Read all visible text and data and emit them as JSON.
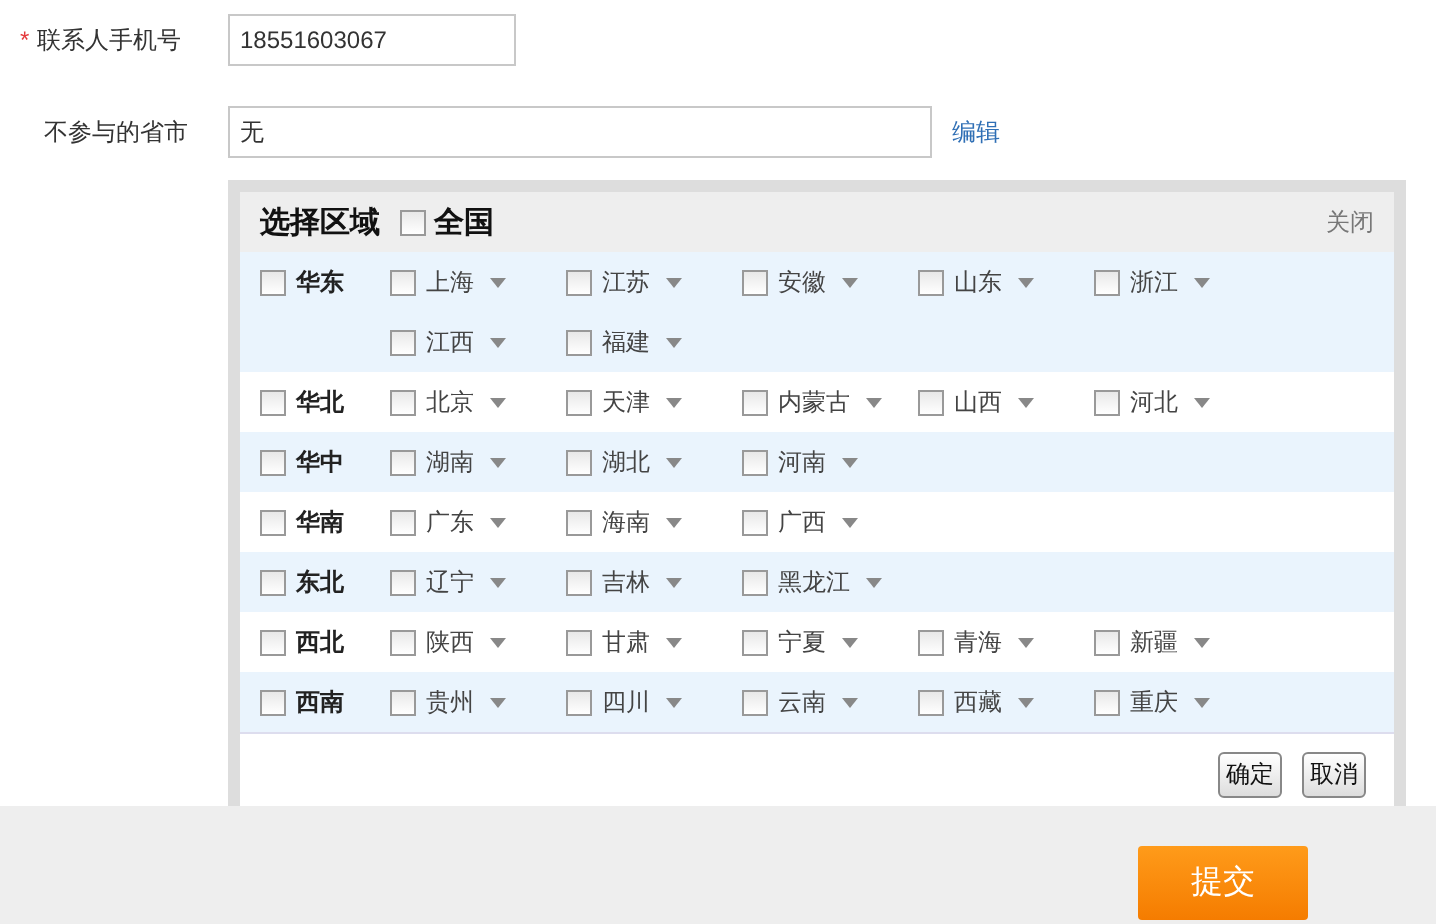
{
  "contact": {
    "label": "联系人手机号",
    "required_mark": "*",
    "value": "18551603067"
  },
  "excluded": {
    "label": "不参与的省市",
    "value": "无",
    "edit_link": "编辑"
  },
  "region_picker": {
    "title": "选择区域",
    "all": {
      "label": "全国",
      "checked": false
    },
    "close": "关闭",
    "regions": [
      {
        "name": "华东",
        "checked": false,
        "provinces": [
          {
            "name": "上海",
            "checked": false
          },
          {
            "name": "江苏",
            "checked": false
          },
          {
            "name": "安徽",
            "checked": false
          },
          {
            "name": "山东",
            "checked": false
          },
          {
            "name": "浙江",
            "checked": false
          },
          {
            "name": "江西",
            "checked": false
          },
          {
            "name": "福建",
            "checked": false
          }
        ]
      },
      {
        "name": "华北",
        "checked": false,
        "provinces": [
          {
            "name": "北京",
            "checked": false
          },
          {
            "name": "天津",
            "checked": false
          },
          {
            "name": "内蒙古",
            "checked": false
          },
          {
            "name": "山西",
            "checked": false
          },
          {
            "name": "河北",
            "checked": false
          }
        ]
      },
      {
        "name": "华中",
        "checked": false,
        "provinces": [
          {
            "name": "湖南",
            "checked": false
          },
          {
            "name": "湖北",
            "checked": false
          },
          {
            "name": "河南",
            "checked": false
          }
        ]
      },
      {
        "name": "华南",
        "checked": false,
        "provinces": [
          {
            "name": "广东",
            "checked": false
          },
          {
            "name": "海南",
            "checked": false
          },
          {
            "name": "广西",
            "checked": false
          }
        ]
      },
      {
        "name": "东北",
        "checked": false,
        "provinces": [
          {
            "name": "辽宁",
            "checked": false
          },
          {
            "name": "吉林",
            "checked": false
          },
          {
            "name": "黑龙江",
            "checked": false
          }
        ]
      },
      {
        "name": "西北",
        "checked": false,
        "provinces": [
          {
            "name": "陕西",
            "checked": false
          },
          {
            "name": "甘肃",
            "checked": false
          },
          {
            "name": "宁夏",
            "checked": false
          },
          {
            "name": "青海",
            "checked": false
          },
          {
            "name": "新疆",
            "checked": false
          }
        ]
      },
      {
        "name": "西南",
        "checked": false,
        "provinces": [
          {
            "name": "贵州",
            "checked": false
          },
          {
            "name": "四川",
            "checked": false
          },
          {
            "name": "云南",
            "checked": false
          },
          {
            "name": "西藏",
            "checked": false
          },
          {
            "name": "重庆",
            "checked": false
          }
        ]
      }
    ],
    "confirm": "确定",
    "cancel": "取消"
  },
  "submit": "提交"
}
